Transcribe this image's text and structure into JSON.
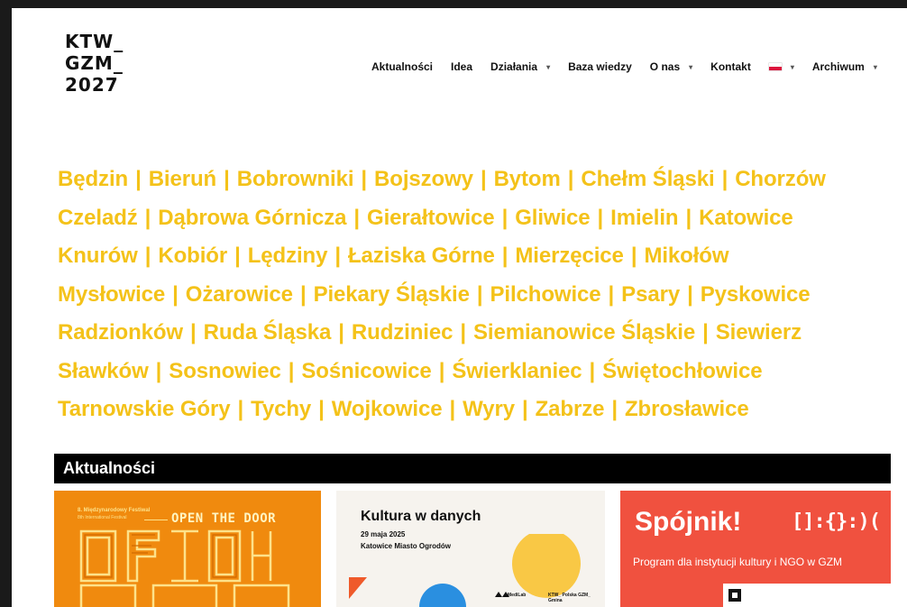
{
  "logo": {
    "line1": "KTW_",
    "line2": "GZM_",
    "line3": "2027"
  },
  "nav": {
    "items": [
      {
        "label": "Aktualności",
        "caret": false
      },
      {
        "label": "Idea",
        "caret": false
      },
      {
        "label": "Działania",
        "caret": true
      },
      {
        "label": "Baza wiedzy",
        "caret": false
      },
      {
        "label": "O nas",
        "caret": true
      },
      {
        "label": "Kontakt",
        "caret": false
      }
    ],
    "caret_symbol": "▾",
    "language": "polish-flag-icon",
    "archive_label": "Archiwum"
  },
  "cities": [
    [
      "Będzin",
      "Bieruń",
      "Bobrowniki",
      "Bojszowy",
      "Bytom",
      "Chełm Śląski",
      "Chorzów"
    ],
    [
      "Czeladź",
      "Dąbrowa Górnicza",
      "Gierałtowice",
      "Gliwice",
      "Imielin",
      "Katowice"
    ],
    [
      "Knurów",
      "Kobiór",
      "Lędziny",
      "Łaziska Górne",
      "Mierzęcice",
      "Mikołów"
    ],
    [
      "Mysłowice",
      "Ożarowice",
      "Piekary Śląskie",
      "Pilchowice",
      "Psary",
      "Pyskowice"
    ],
    [
      "Radzionków",
      "Ruda Śląska",
      "Rudziniec",
      "Siemianowice Śląskie",
      "Siewierz"
    ],
    [
      "Sławków",
      "Sosnowiec",
      "Sośnicowice",
      "Świerklaniec",
      "Świętochłowice"
    ],
    [
      "Tarnowskie Góry",
      "Tychy",
      "Wojkowice",
      "Wyry",
      "Zabrze",
      "Zbrosławice"
    ]
  ],
  "separator": "|",
  "news": {
    "heading": "Aktualności",
    "card1": {
      "small": "8. Międzynarodowy Festiwal",
      "small2": "8th International Festival",
      "title": "OPEN THE DOOR"
    },
    "card2": {
      "title": "Kultura w danych",
      "date": "29 maja 2025",
      "place": "Katowice Miasto Ogrodów",
      "foot1": "MediLab",
      "foot2": "KTW_ Polska GZM_ Gmina"
    },
    "card3": {
      "title": "Spójnik!",
      "symbols": "[]:{}:)(",
      "subtitle": "Program dla instytucji kultury i NGO w GZM"
    }
  },
  "colors": {
    "accent": "#f4c219",
    "orange": "#f08a0e",
    "red": "#f0513f"
  }
}
